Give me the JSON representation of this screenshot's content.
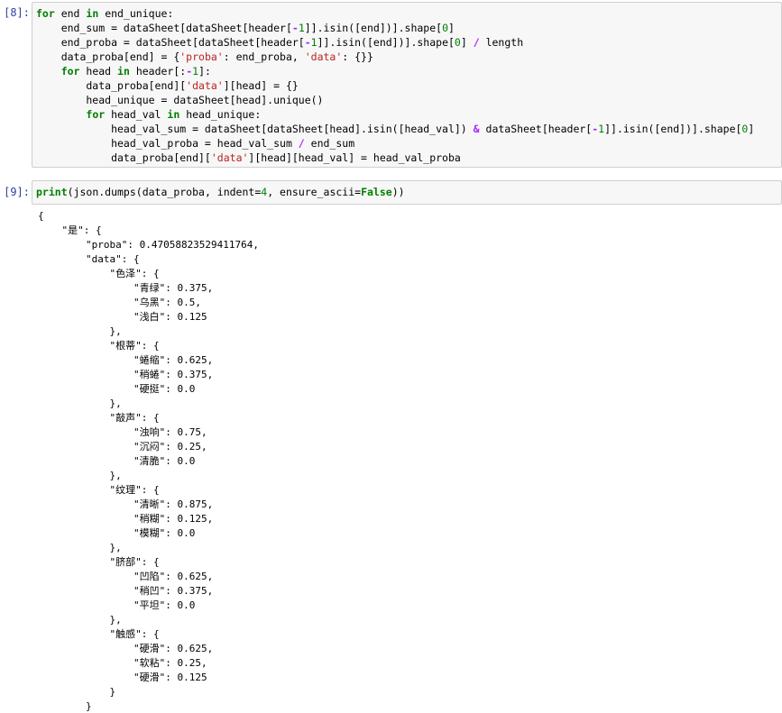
{
  "cells": [
    {
      "prompt": "[8]:",
      "tokens": [
        [
          [
            "kw",
            "for"
          ],
          [
            "",
            "end "
          ],
          [
            "kw",
            "in"
          ],
          [
            "",
            "end_unique:"
          ]
        ],
        [
          [
            "",
            "    end_sum = dataSheet[dataSheet[header["
          ],
          [
            "op",
            "-"
          ],
          [
            "num",
            "1"
          ],
          [
            "",
            "]].isin([end])].shape["
          ],
          [
            "num",
            "0"
          ],
          [
            "",
            "]"
          ]
        ],
        [
          [
            "",
            "    end_proba = dataSheet[dataSheet[header["
          ],
          [
            "op",
            "-"
          ],
          [
            "num",
            "1"
          ],
          [
            "",
            "]].isin([end])].shape["
          ],
          [
            "num",
            "0"
          ],
          [
            "",
            "] "
          ],
          [
            "op",
            "/"
          ],
          [
            "",
            ""
          ],
          [
            "",
            "length"
          ]
        ],
        [
          [
            "",
            "    data_proba[end] = {"
          ],
          [
            "str",
            "'proba'"
          ],
          [
            "",
            ": end_proba, "
          ],
          [
            "str",
            "'data'"
          ],
          [
            "",
            ": {}}"
          ]
        ],
        [
          [
            "",
            "    "
          ],
          [
            "kw",
            "for"
          ],
          [
            "",
            "head "
          ],
          [
            "kw",
            "in"
          ],
          [
            "",
            "header[:"
          ],
          [
            "op",
            "-"
          ],
          [
            "num",
            "1"
          ],
          [
            "",
            "]:"
          ]
        ],
        [
          [
            "",
            "        data_proba[end]["
          ],
          [
            "str",
            "'data'"
          ],
          [
            "",
            "][head] = {}"
          ]
        ],
        [
          [
            "",
            "        head_unique = dataSheet[head].unique()"
          ]
        ],
        [
          [
            "",
            "        "
          ],
          [
            "kw",
            "for"
          ],
          [
            "",
            "head_val "
          ],
          [
            "kw",
            "in"
          ],
          [
            "",
            "head_unique:"
          ]
        ],
        [
          [
            "",
            "            head_val_sum = dataSheet[dataSheet[head].isin([head_val]) "
          ],
          [
            "op",
            "&"
          ],
          [
            "",
            ""
          ],
          [
            "",
            "dataSheet[header["
          ],
          [
            "op",
            "-"
          ],
          [
            "num",
            "1"
          ],
          [
            "",
            "]].isin([end])].shape["
          ],
          [
            "num",
            "0"
          ],
          [
            "",
            "]"
          ]
        ],
        [
          [
            "",
            "            head_val_proba = head_val_sum "
          ],
          [
            "op",
            "/"
          ],
          [
            "",
            ""
          ],
          [
            "",
            "end_sum"
          ]
        ],
        [
          [
            "",
            "            data_proba[end]["
          ],
          [
            "str",
            "'data'"
          ],
          [
            "",
            "][head][head_val] = head_val_proba"
          ]
        ]
      ]
    },
    {
      "prompt": "[9]:",
      "tokens": [
        [
          [
            "kw",
            "print"
          ],
          [
            "",
            "(json.dumps(data_proba, indent="
          ],
          [
            "num",
            "4"
          ],
          [
            "",
            ", ensure_ascii="
          ],
          [
            "kw",
            "False"
          ],
          [
            "",
            "))"
          ]
        ]
      ]
    }
  ],
  "output_lines": [
    "{",
    "    \"是\": {",
    "        \"proba\": 0.47058823529411764,",
    "        \"data\": {",
    "            \"色泽\": {",
    "                \"青绿\": 0.375,",
    "                \"乌黑\": 0.5,",
    "                \"浅白\": 0.125",
    "            },",
    "            \"根蒂\": {",
    "                \"蜷缩\": 0.625,",
    "                \"稍蜷\": 0.375,",
    "                \"硬挺\": 0.0",
    "            },",
    "            \"敲声\": {",
    "                \"浊响\": 0.75,",
    "                \"沉闷\": 0.25,",
    "                \"清脆\": 0.0",
    "            },",
    "            \"纹理\": {",
    "                \"清晰\": 0.875,",
    "                \"稍糊\": 0.125,",
    "                \"模糊\": 0.0",
    "            },",
    "            \"脐部\": {",
    "                \"凹陷\": 0.625,",
    "                \"稍凹\": 0.375,",
    "                \"平坦\": 0.0",
    "            },",
    "            \"触感\": {",
    "                \"硬滑\": 0.625,",
    "                \"软粘\": 0.25,",
    "                \"硬滑\": 0.125",
    "            }",
    "        }"
  ],
  "colors": {
    "keyword": "#008000",
    "operator": "#aa22ff",
    "string": "#ba2121",
    "number": "#008000",
    "prompt": "#303f9f",
    "cell_bg": "#f7f7f7",
    "cell_border": "#cfcfcf"
  }
}
